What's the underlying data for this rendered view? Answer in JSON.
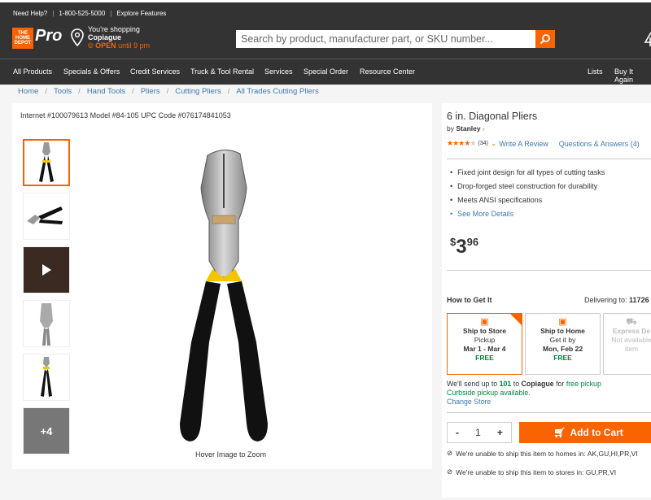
{
  "topbar": {
    "help": "Need Help?",
    "phone": "1-800-525-5000",
    "explore": "Explore Features"
  },
  "header": {
    "logo_text": "THE HOME DEPOT",
    "pro": "Pro",
    "store_line1": "You're shopping",
    "store_name": "Copiague",
    "open_label": "© OPEN",
    "open_until": "until 9 pm",
    "search_placeholder": "Search by product, manufacturer part, or SKU number..."
  },
  "nav": {
    "items": [
      "All Products",
      "Specials & Offers",
      "Credit Services",
      "Truck & Tool Rental",
      "Services",
      "Special Order",
      "Resource Center"
    ],
    "right": [
      "Lists",
      "Buy It Again"
    ]
  },
  "breadcrumb": [
    "Home",
    "Tools",
    "Hand Tools",
    "Pliers",
    "Cutting Pliers",
    "All Trades Cutting Pliers"
  ],
  "product": {
    "meta": "Internet #100079613   Model #84-105   UPC Code #076174841053",
    "hover_text": "Hover Image to Zoom",
    "more_images": "+4",
    "title": "6 in. Diagonal Pliers",
    "by": "by",
    "brand": "Stanley",
    "review_count": "(34)",
    "write_review": "Write A Review",
    "qa": "Questions & Answers (4)",
    "bullets": [
      "Fixed joint design for all types of cutting tasks",
      "Drop-forged steel construction for durability",
      "Meets ANSI specifications"
    ],
    "see_more": "See More Details",
    "price_symbol": "$",
    "price_dollars": "3",
    "price_cents": "96",
    "rating": 4
  },
  "fulfillment": {
    "how": "How to Get It",
    "delivering_label": "Delivering to:",
    "zip": "11726",
    "cards": [
      {
        "title": "Ship to Store",
        "line1": "Pickup",
        "line2": "Mar 1 - Mar 4",
        "line3": "FREE"
      },
      {
        "title": "Ship to Home",
        "line1": "Get it by",
        "line2": "Mon, Feb 22",
        "line3": "FREE"
      },
      {
        "title": "Express De",
        "line1": "Not available",
        "line2": "item",
        "line3": ""
      }
    ],
    "note_pre": "We'll send up to",
    "note_qty": "101",
    "note_to": "to",
    "note_store": "Copiague",
    "note_for": "for",
    "note_free": "free pickup",
    "curbside": "Curbside pickup available.",
    "change": "Change Store"
  },
  "cart": {
    "minus": "-",
    "qty": "1",
    "plus": "+",
    "add": "Add to Cart"
  },
  "warnings": [
    "We're unable to ship this item to homes in: AK,GU,HI,PR,VI",
    "We're unable to ship this item to stores in: GU,PR,VI"
  ],
  "colors": {
    "brand": "#f96302",
    "link": "#3e7aab",
    "free": "#00873c"
  }
}
